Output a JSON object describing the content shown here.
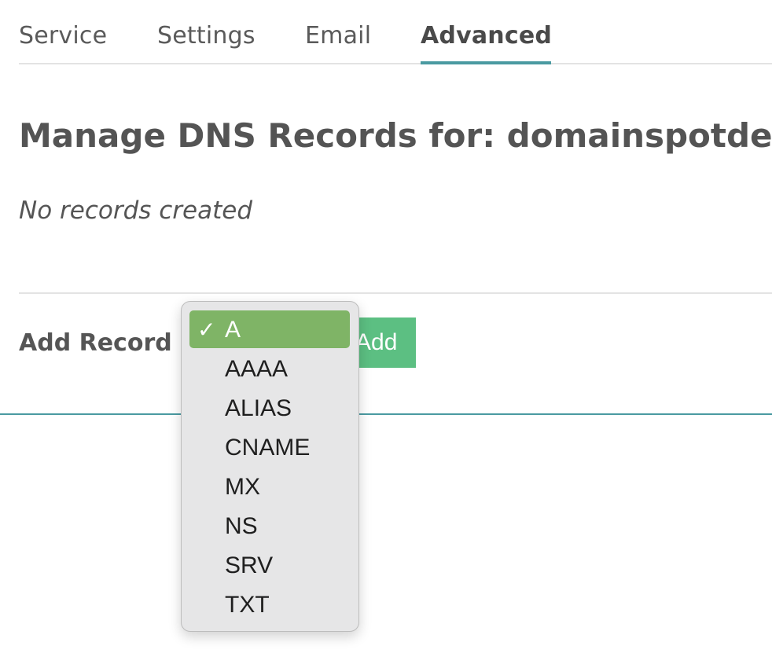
{
  "tabs": [
    {
      "label": "Service"
    },
    {
      "label": "Settings"
    },
    {
      "label": "Email"
    },
    {
      "label": "Advanced",
      "active": true
    }
  ],
  "main": {
    "title": "Manage DNS Records for: domainspotdemo",
    "empty_message": "No records created",
    "add_record_label": "Add Record",
    "add_button_label": "Add"
  },
  "record_type_select": {
    "selected": "A",
    "check_glyph": "✓",
    "options": [
      "A",
      "AAAA",
      "ALIAS",
      "CNAME",
      "MX",
      "NS",
      "SRV",
      "TXT"
    ]
  },
  "colors": {
    "accent": "#4a9aa1",
    "add_button": "#5cbf82",
    "selected_option": "#7fb466"
  }
}
